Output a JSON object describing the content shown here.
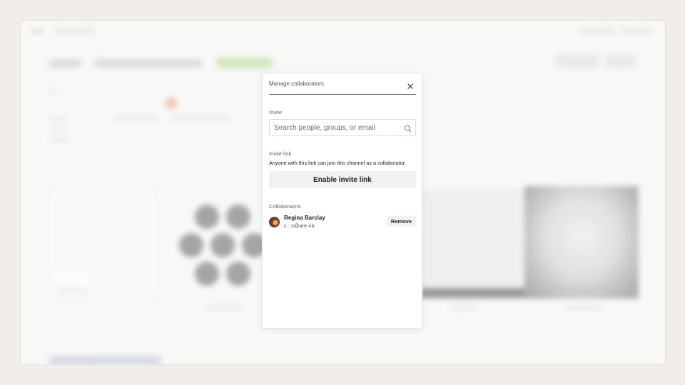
{
  "modal": {
    "title": "Manage collaborators",
    "invite_label": "Invite",
    "search_placeholder": "Search people, groups, or email",
    "invite_link_label": "Invite link",
    "invite_link_description": "Anyone with this link can join this channel as a collaborator.",
    "enable_button": "Enable invite link",
    "collaborators_label": "Collaborators",
    "collaborators": [
      {
        "name": "Regina Barclay",
        "email": "c...s@are.na",
        "remove_label": "Remove"
      }
    ]
  },
  "icons": {
    "close": "close-icon",
    "search": "search-icon",
    "avatar": "avatar"
  },
  "colors": {
    "page_background": "#f1eeea",
    "modal_background": "#ffffff",
    "button_background": "#f1f1f1",
    "accent_green": "#cfe6b8"
  }
}
